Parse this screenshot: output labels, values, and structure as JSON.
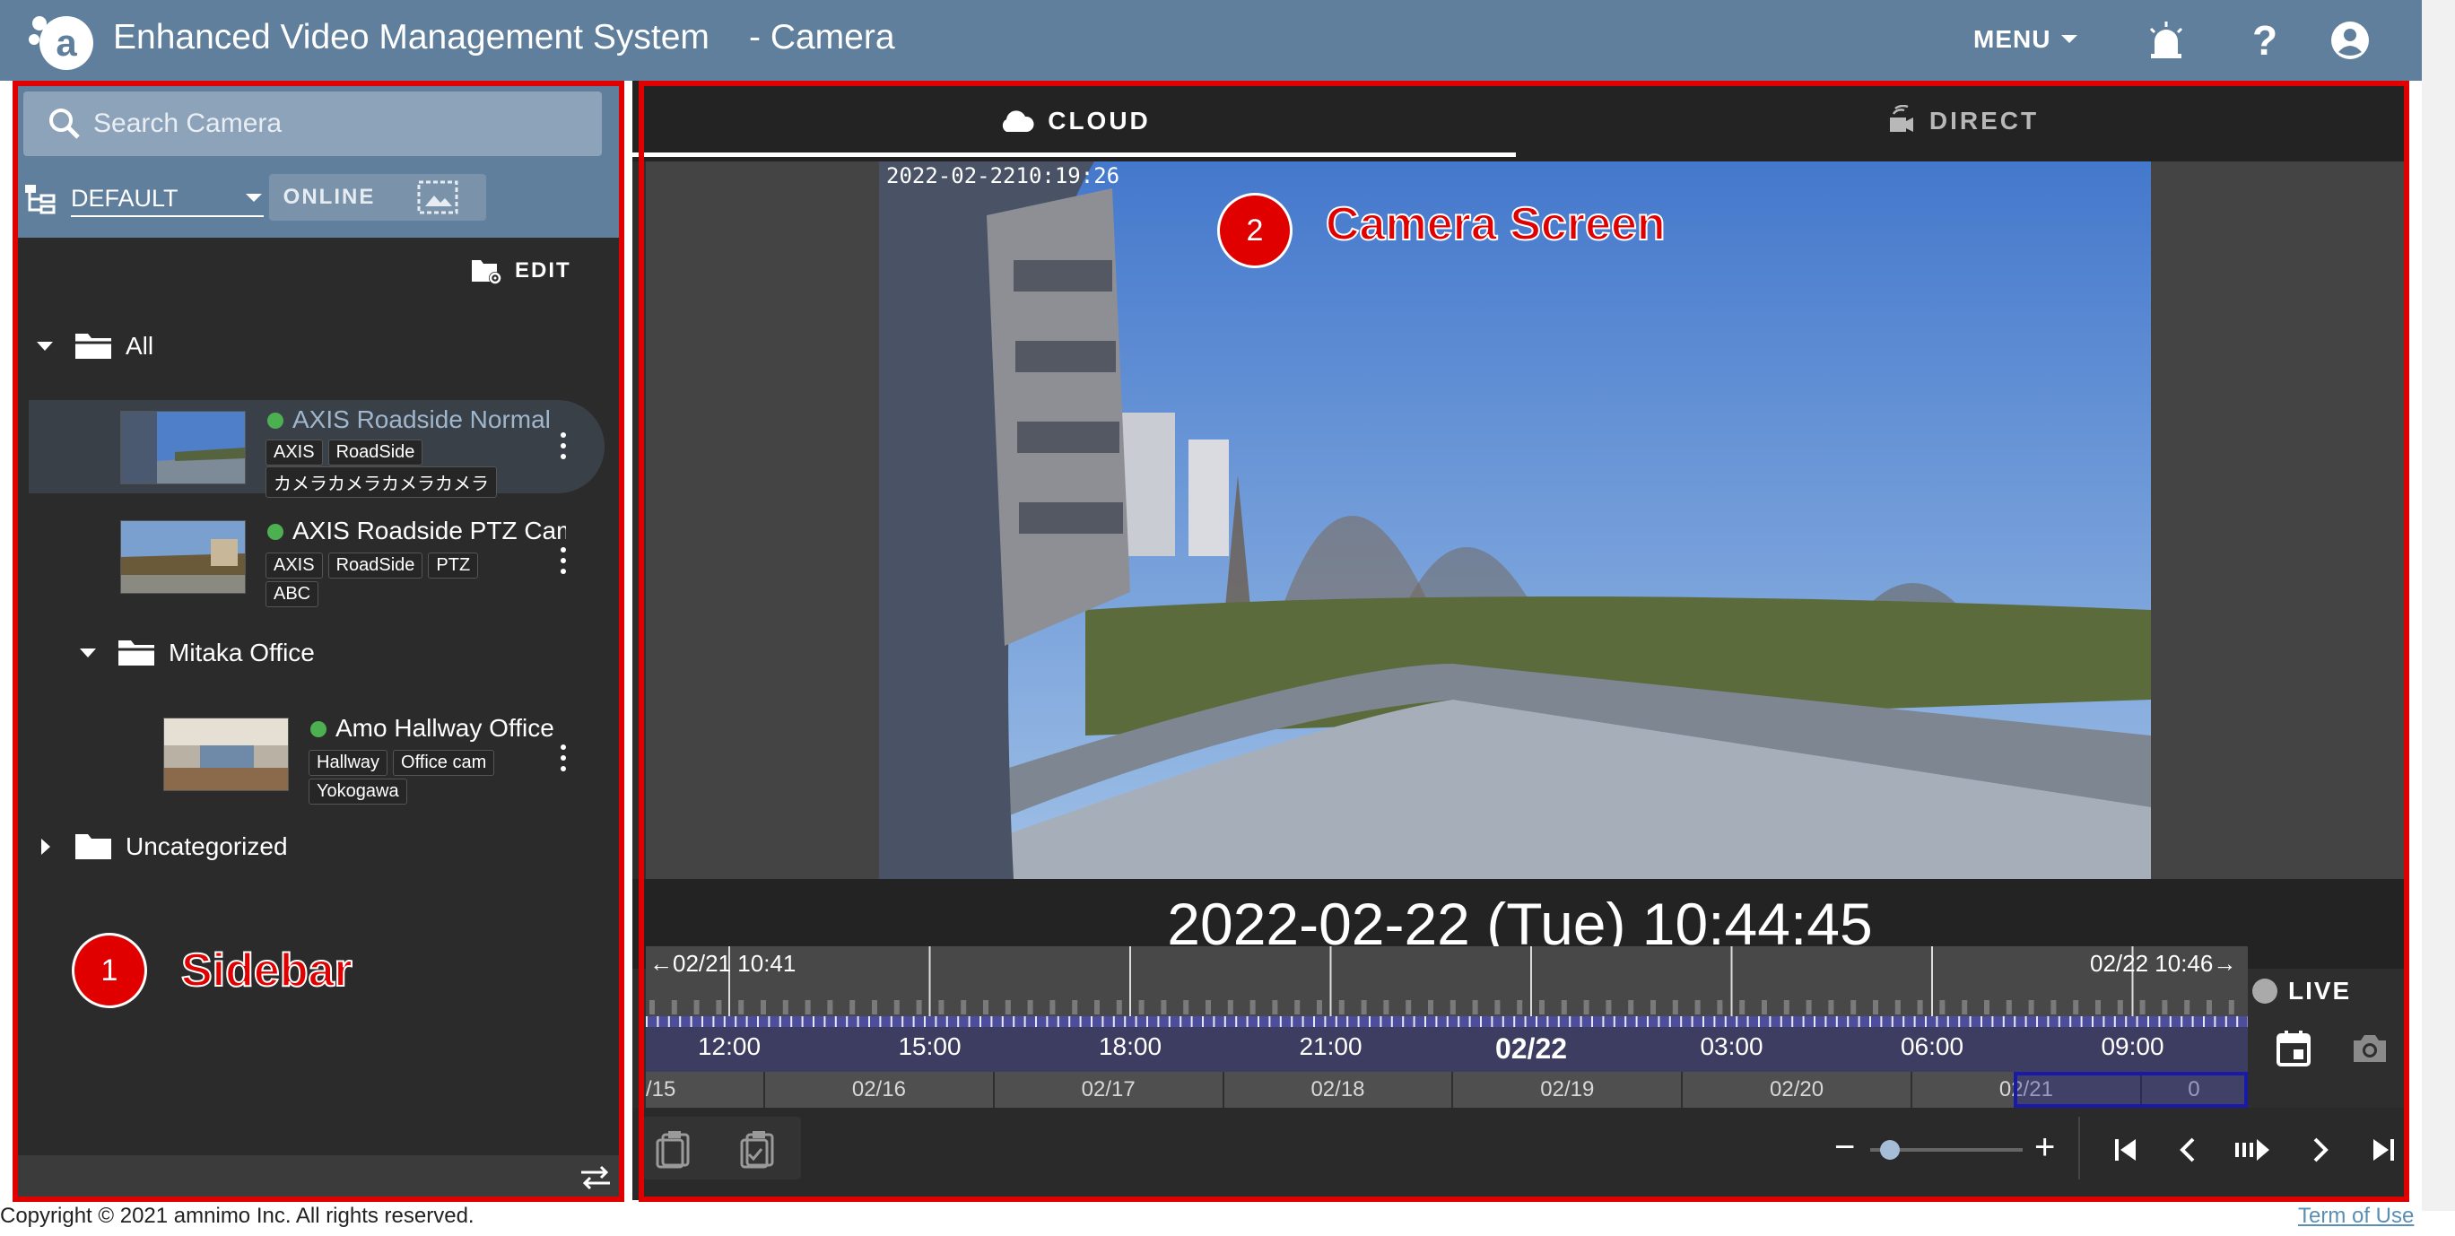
{
  "header": {
    "app_title": "Enhanced Video Management System",
    "page_suffix": "- Camera",
    "menu_label": "MENU",
    "icons": [
      "alert-icon",
      "help-icon",
      "account-icon"
    ]
  },
  "sidebar": {
    "search_placeholder": "Search Camera",
    "group_value": "DEFAULT",
    "online_label": "ONLINE",
    "edit_label": "EDIT",
    "root_folder": "All",
    "cameras_root": [
      {
        "name": "AXIS Roadside Normal",
        "tags": [
          "AXIS",
          "RoadSide",
          "カメラカメラカメラカメラ"
        ],
        "status": "online"
      },
      {
        "name": "AXIS Roadside PTZ Cam",
        "tags": [
          "AXIS",
          "RoadSide",
          "PTZ",
          "ABC"
        ],
        "status": "online"
      }
    ],
    "subfolder": "Mitaka Office",
    "cameras_sub": [
      {
        "name": "Amo Hallway Office",
        "tags": [
          "Hallway",
          "Office cam",
          "Yokogawa"
        ],
        "status": "online"
      }
    ],
    "uncategorized": "Uncategorized"
  },
  "main": {
    "tab_cloud": "CLOUD",
    "tab_direct": "DIRECT",
    "video_timestamp": "2022-02-2210:19:26",
    "current_time": "2022-02-22 (Tue) 10:44:45",
    "timeline": {
      "range_start": "02/21 10:41",
      "range_end": "02/22 10:46",
      "hour_labels": [
        "12:00",
        "15:00",
        "18:00",
        "21:00",
        "02/22",
        "03:00",
        "06:00",
        "09:00"
      ],
      "day_labels": [
        "/15",
        "02/16",
        "02/17",
        "02/18",
        "02/19",
        "02/20",
        "02/21",
        "0"
      ]
    },
    "live_label": "LIVE",
    "zoom_minus": "−",
    "zoom_plus": "+",
    "zoom_level": 0.0
  },
  "annotations": {
    "sidebar_number": "1",
    "sidebar_label": "Sidebar",
    "camera_number": "2",
    "camera_label": "Camera Screen"
  },
  "footer": {
    "copyright": "Copyright © 2021 amnimo Inc. All rights reserved.",
    "terms": "Term of Use"
  },
  "colors": {
    "header": "#5f7f9c",
    "sidebar_bg": "#2b2b2b",
    "online_dot": "#4caf50",
    "annotation_red": "#e00000",
    "timeline_accent": "#3d3d62"
  }
}
